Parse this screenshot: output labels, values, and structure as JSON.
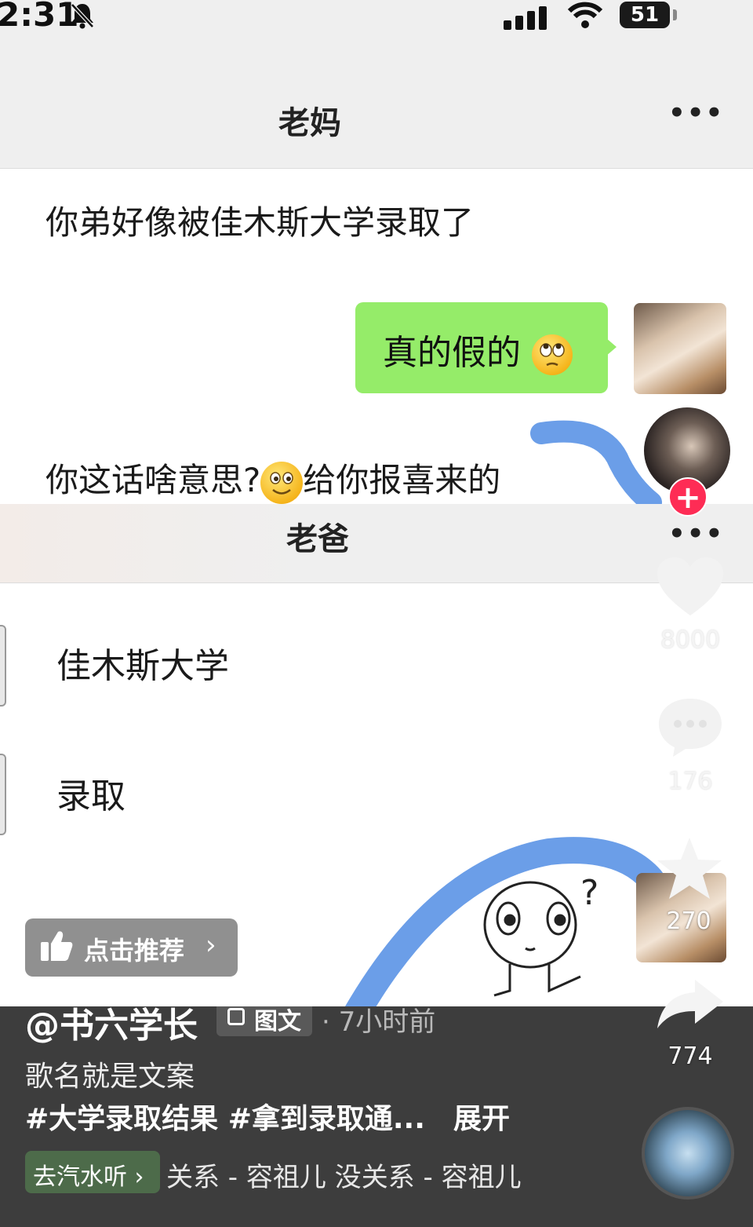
{
  "status_bar": {
    "time": "2:31",
    "battery": "51",
    "icons": [
      "bell-muted-icon",
      "signal-icon",
      "wifi-icon",
      "battery-icon"
    ]
  },
  "chat_mom": {
    "title": "老妈",
    "more": "•••",
    "messages": [
      {
        "side": "left",
        "text": "你弟好像被佳木斯大学录取了"
      },
      {
        "side": "right",
        "text": "真的假的",
        "emoji": "rolling-eyes-emoji"
      },
      {
        "side": "left",
        "text_before": "你这话啥意思?",
        "emoji": "smile-emoji",
        "text_after": "给你报喜来的"
      }
    ]
  },
  "chat_dad": {
    "title": "老爸",
    "more": "•••",
    "messages": [
      {
        "side": "left",
        "text": "佳木斯大学"
      },
      {
        "side": "left",
        "text": "录取"
      }
    ]
  },
  "rail": {
    "likes": "8000",
    "comments": "176",
    "favorites": "270",
    "shares": "774"
  },
  "recommend": {
    "label": "点击推荐"
  },
  "post": {
    "author": "@书六学长",
    "type_tag": "图文",
    "time_ago": "· 7小时前",
    "caption": "歌名就是文案",
    "hashtags": "#大学录取结果 #拿到录取通...",
    "expand": "展开",
    "music_button": "去汽水听",
    "music_text": "关系 - 容祖儿    没关系 - 容祖儿"
  },
  "colors": {
    "wechat_green": "#95ec69",
    "follow_red": "#fe2c55",
    "doodle_blue": "#5b93e6"
  }
}
